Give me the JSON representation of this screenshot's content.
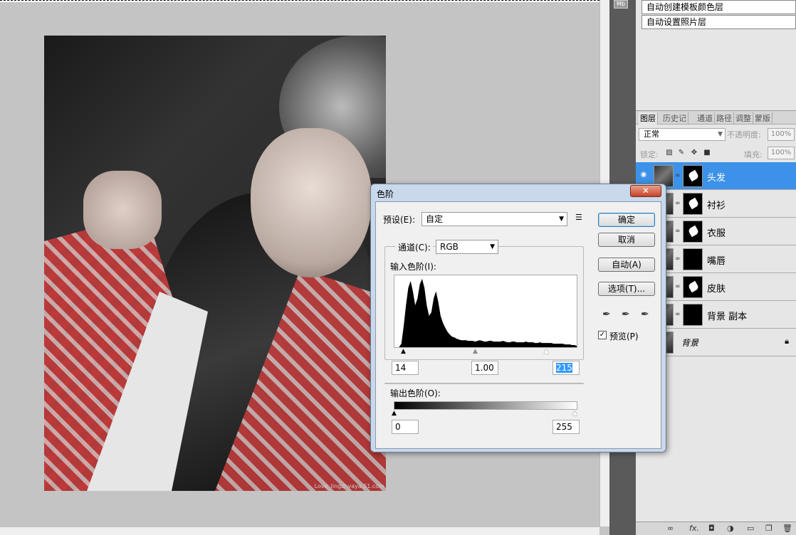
{
  "canvas": {
    "watermark": "Love_lingzhyaya.51.com"
  },
  "strip": {
    "mb_label": "Mb"
  },
  "actions": [
    "自动创建模板颜色层",
    "自动设置照片层"
  ],
  "panel_tabs": [
    "图层",
    "历史记",
    "通道",
    "路径",
    "调整",
    "蒙版"
  ],
  "blend_mode": "正常",
  "opacity_label": "不透明度:",
  "opacity_value": "100%",
  "lock_label": "锁定:",
  "fill_label": "填充:",
  "fill_value": "100%",
  "layers": [
    {
      "name": "头发",
      "selected": true
    },
    {
      "name": "衬衫",
      "selected": false
    },
    {
      "name": "衣服",
      "selected": false
    },
    {
      "name": "嘴唇",
      "selected": false
    },
    {
      "name": "皮肤",
      "selected": false
    },
    {
      "name": "背景 副本",
      "selected": false
    },
    {
      "name": "背景",
      "selected": false
    }
  ],
  "dialog": {
    "title": "色阶",
    "close_label": "✕",
    "preset_label": "预设(E):",
    "preset_value": "自定",
    "channel_label": "通道(C):",
    "channel_value": "RGB",
    "input_label": "输入色阶(I):",
    "input_black": "14",
    "input_gamma": "1.00",
    "input_white": "215",
    "output_label": "输出色阶(O):",
    "output_black": "0",
    "output_white": "255",
    "buttons": {
      "ok": "确定",
      "cancel": "取消",
      "auto": "自动(A)",
      "options": "选项(T)..."
    },
    "preview_label": "预览(P)",
    "preview_checked": true,
    "histogram": [
      0,
      0,
      0,
      5,
      30,
      60,
      85,
      95,
      80,
      60,
      70,
      90,
      98,
      85,
      60,
      45,
      50,
      70,
      80,
      65,
      45,
      35,
      28,
      22,
      18,
      15,
      14,
      12,
      11,
      10,
      10,
      10,
      9,
      9,
      9,
      8,
      9,
      10,
      9,
      8,
      8,
      9,
      9,
      8,
      8,
      8,
      8,
      9,
      8,
      7,
      7,
      8,
      8,
      7,
      7,
      7,
      7,
      8,
      7,
      7,
      7,
      6,
      6,
      7,
      6,
      6,
      6,
      6,
      6,
      5,
      5,
      5,
      5,
      5,
      4,
      4,
      4,
      3,
      3,
      2
    ]
  }
}
